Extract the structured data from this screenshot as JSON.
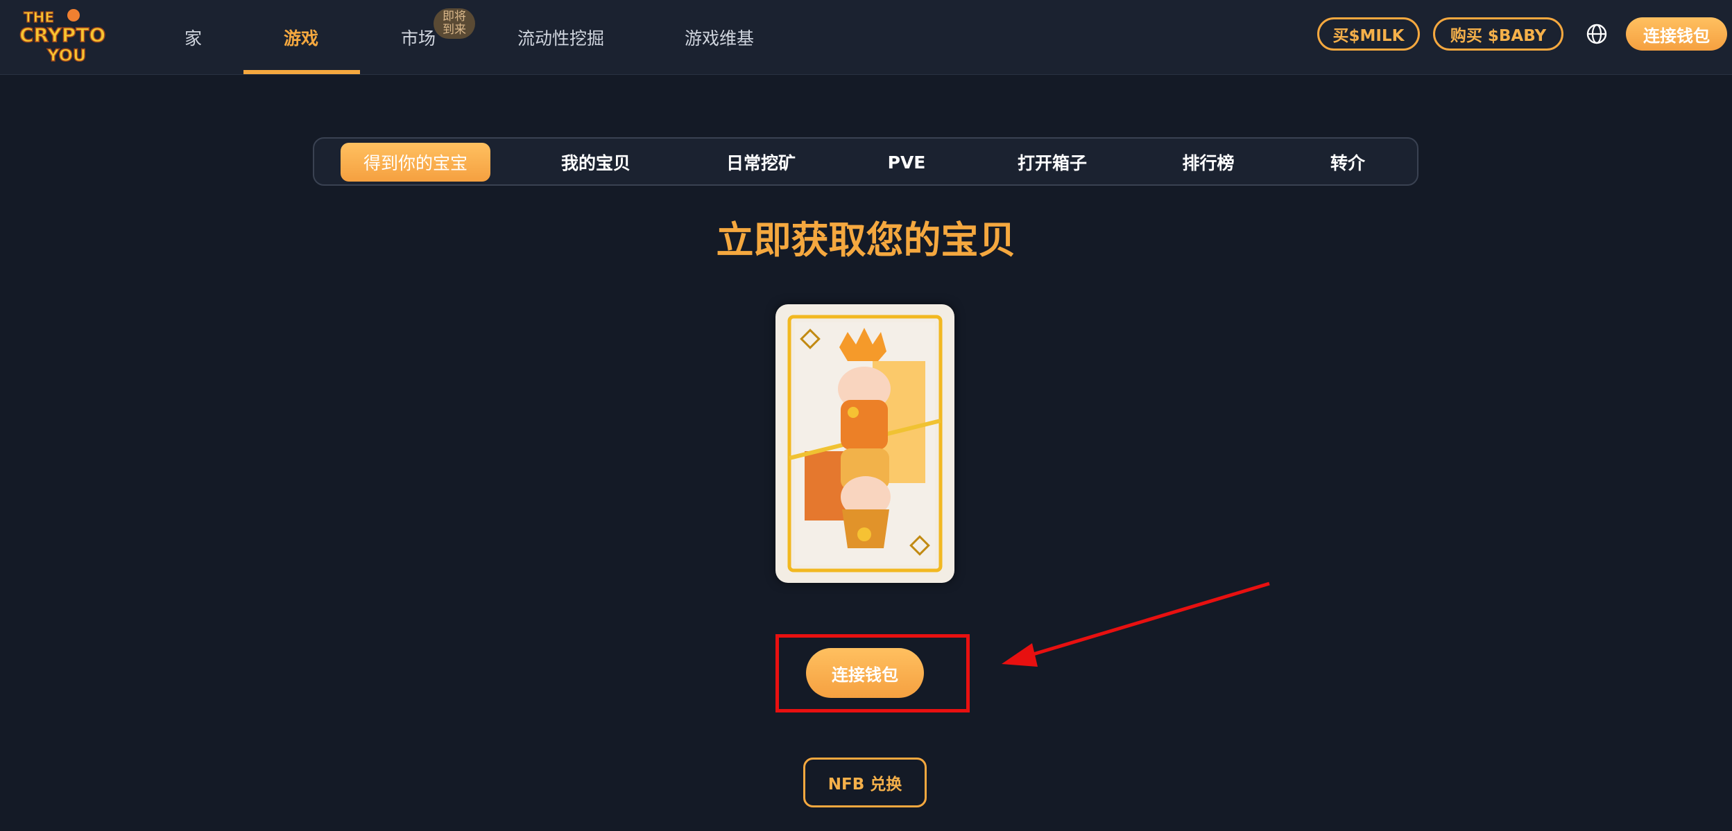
{
  "brand": {
    "logo_text": [
      "THE",
      "CRYPTO",
      "YOU"
    ]
  },
  "nav": {
    "home": "家",
    "game": "游戏",
    "market": "市场",
    "market_badge": [
      "即将",
      "到来"
    ],
    "liquidity": "流动性挖掘",
    "game_fund": "游戏维基"
  },
  "header_actions": {
    "buy_milk": "买$MILK",
    "buy_baby": "购买 $BABY",
    "connect_wallet": "连接钱包"
  },
  "tabs": [
    {
      "label": "得到你的宝宝",
      "active": true
    },
    {
      "label": "我的宝贝",
      "active": false
    },
    {
      "label": "日常挖矿",
      "active": false
    },
    {
      "label": "PVE",
      "active": false
    },
    {
      "label": "打开箱子",
      "active": false
    },
    {
      "label": "排行榜",
      "active": false
    },
    {
      "label": "转介",
      "active": false
    }
  ],
  "main": {
    "headline": "立即获取您的宝贝",
    "connect_button": "连接钱包",
    "nfb_button": "NFB 兑换"
  },
  "colors": {
    "accent": "#f5a83f",
    "background": "#141a26",
    "navbar": "#1b2230",
    "annotation_red": "#e81010"
  }
}
